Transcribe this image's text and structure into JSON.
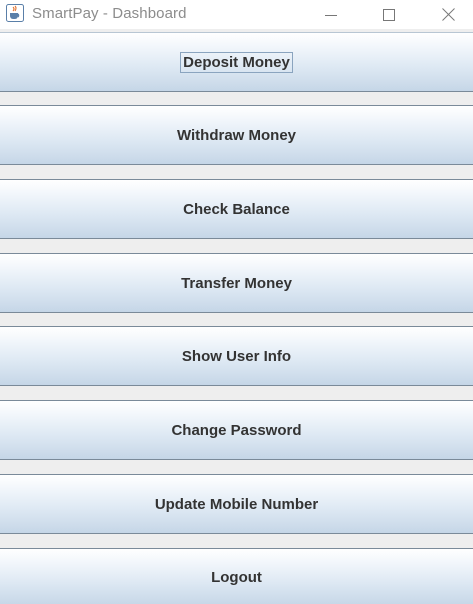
{
  "window": {
    "title": "SmartPay - Dashboard",
    "icons": {
      "app": "java-cup-icon",
      "minimize": "minimize-icon",
      "maximize": "maximize-icon",
      "close": "close-icon"
    }
  },
  "buttons": [
    {
      "label": "Deposit Money",
      "focused": true
    },
    {
      "label": "Withdraw Money"
    },
    {
      "label": "Check Balance"
    },
    {
      "label": "Transfer Money"
    },
    {
      "label": "Show User Info"
    },
    {
      "label": "Change Password"
    },
    {
      "label": "Update Mobile Number"
    },
    {
      "label": "Logout"
    }
  ],
  "colors": {
    "button_text": "#333333",
    "button_border": "#7a8a99",
    "background": "#eeeeee",
    "title_text": "#8c8c8c"
  }
}
